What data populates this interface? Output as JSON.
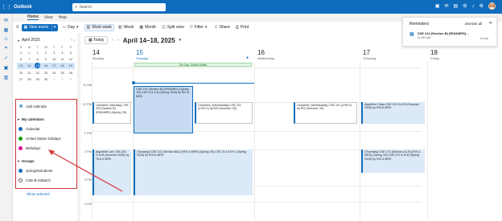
{
  "app": {
    "name": "Outlook"
  },
  "search": {
    "placeholder": "Search"
  },
  "tabs": [
    "Home",
    "View",
    "Help"
  ],
  "ribbon": {
    "new_event": "New event",
    "day": "Day",
    "work_week": "Work week",
    "week": "Week",
    "month": "Month",
    "split_view": "Split view",
    "filter": "Filter",
    "share": "Share",
    "print": "Print"
  },
  "mini_calendar": {
    "title": "April 2025",
    "weekdays": [
      "S",
      "M",
      "T",
      "W",
      "T",
      "F",
      "S"
    ],
    "weeks": [
      [
        "30",
        "31",
        "1",
        "2",
        "3",
        "4",
        "5"
      ],
      [
        "6",
        "7",
        "8",
        "9",
        "10",
        "11",
        "12"
      ],
      [
        "13",
        "14",
        "15",
        "16",
        "17",
        "18",
        "19"
      ],
      [
        "20",
        "21",
        "22",
        "23",
        "24",
        "25",
        "26"
      ],
      [
        "27",
        "28",
        "29",
        "30",
        "1",
        "2",
        "3"
      ]
    ],
    "today": "15"
  },
  "calendars": {
    "add": "Add calendar",
    "my_calendars_header": "My calendars",
    "items": [
      {
        "label": "Calendar",
        "color": "#0f6cbd"
      },
      {
        "label": "United States holidays",
        "color": "#13a10e"
      },
      {
        "label": "Birthdays",
        "color": "#e3008c"
      }
    ],
    "groups_header": "Groups",
    "groups": [
      {
        "label": "spring25students",
        "color": "#0f6cbd"
      },
      {
        "label": "CSE-B-22Batch",
        "color": ""
      }
    ],
    "show_selected": "Show selected"
  },
  "calendar_view": {
    "today_button": "Today",
    "range": "April 14–18, 2025",
    "days": [
      {
        "num": "14",
        "name": "Monday"
      },
      {
        "num": "15",
        "name": "Tuesday"
      },
      {
        "num": "16",
        "name": "Wednesday"
      },
      {
        "num": "17",
        "name": "Thursday"
      },
      {
        "num": "18",
        "name": "Friday"
      }
    ],
    "hours": [
      "11 AM",
      "12 PM",
      "1 PM",
      "2 PM",
      "3 PM",
      "4 PM"
    ],
    "holiday": "Tax Day; United States",
    "events": [
      {
        "id": "ev-tue-1",
        "text": "CSE 214 (Section B) (RIS&MRS) (Spring '25) CSE 214 S-B (Spring 2025) by RIS & MRS"
      },
      {
        "id": "ev-mon-1",
        "text": "Canceled: (Monday) CSE 203 (Section B) (RIS&MRS) (Spring '25)"
      },
      {
        "id": "ev-wed-1",
        "text": "Canceled: (Wednesday) CSE 221 (4+B+C) by RIS (Summer '25)"
      },
      {
        "id": "ev-wed-2",
        "text": "Canceled: (Wednesday) CSE 221 (4+B+C) by RIS (Summer '25)"
      },
      {
        "id": "ev-fri-1",
        "text": "Algorithm Class CSE 225 S-A+B (Summer 2025) by RIS & MRS"
      },
      {
        "id": "ev-mon-2",
        "text": "Algorithm Lab CSE 226 S-A+B (Summer 2025) by TKA & MRS"
      },
      {
        "id": "ev-tue-2",
        "text": "(Tuesday) CSE 214 (Section B&C) (RIS & MRS) (Spring '25) CSE 214 S-B+C (Spring 2025) by RIS & MRS"
      },
      {
        "id": "ev-thu-1",
        "text": "(Thursday) CSE 272 (Section A & B) (RIS & MRS) (Spring '25) CSE 272 S-A+B (Spring 2025) by RIS & MRS"
      }
    ]
  },
  "reminders": {
    "title": "Reminders",
    "dismiss_all": "Dismiss all",
    "event_title": "CSE 214 (Section B) (RIS&MRS)...",
    "event_time": "11:00 AM",
    "minutes": "8 min"
  }
}
